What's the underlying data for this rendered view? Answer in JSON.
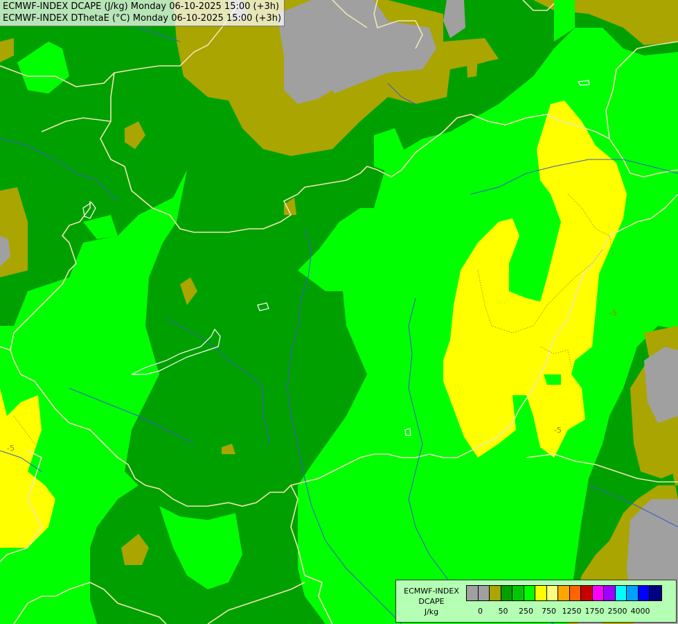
{
  "title": {
    "line1": "ECMWF-INDEX DCAPE (J/kg) Monday 06-10-2025 15:00 (+3h)",
    "line2": "ECMWF-INDEX DThetaE (°C) Monday 06-10-2025 15:00 (+3h)"
  },
  "map_labels": {
    "contour_a": "-5",
    "contour_b": "-5",
    "contour_c": "-5"
  },
  "legend": {
    "line1": "ECMWF-INDEX",
    "line2": "DCAPE",
    "line3": "J/kg",
    "colors": [
      "#a0a0a0",
      "#a0a0a0",
      "#aaa500",
      "#00a000",
      "#00c800",
      "#00ff00",
      "#ffff00",
      "#ffff80",
      "#ffa500",
      "#ff6400",
      "#c80000",
      "#ff00ff",
      "#a000ff",
      "#00ffff",
      "#00a0ff",
      "#0000ff",
      "#000080"
    ],
    "ticks": [
      "0",
      "50",
      "250",
      "750",
      "1250",
      "1750",
      "2500",
      "4000"
    ]
  },
  "palette": {
    "gray": "#a0a0a0",
    "olive": "#aaa500",
    "dark_green": "#00a000",
    "lime": "#00ff00",
    "yellow": "#ffff00",
    "border": "#f0e6b4",
    "river": "#3c5ac8",
    "lake": "#ffffff"
  }
}
